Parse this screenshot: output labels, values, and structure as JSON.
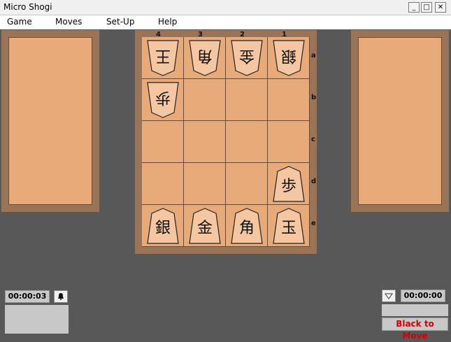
{
  "window": {
    "title": "Micro Shogi",
    "min": "_",
    "max": "□",
    "close": "✕"
  },
  "menu": [
    "Game",
    "Moves",
    "Set-Up",
    "Help"
  ],
  "board": {
    "files": [
      "4",
      "3",
      "2",
      "1"
    ],
    "ranks": [
      "a",
      "b",
      "c",
      "d",
      "e"
    ],
    "pieces": [
      {
        "char": "王",
        "file": "4",
        "rank": "a",
        "side": "white"
      },
      {
        "char": "角",
        "file": "3",
        "rank": "a",
        "side": "white"
      },
      {
        "char": "金",
        "file": "2",
        "rank": "a",
        "side": "white"
      },
      {
        "char": "銀",
        "file": "1",
        "rank": "a",
        "side": "white"
      },
      {
        "char": "歩",
        "file": "4",
        "rank": "b",
        "side": "white"
      },
      {
        "char": "歩",
        "file": "1",
        "rank": "d",
        "side": "black"
      },
      {
        "char": "銀",
        "file": "4",
        "rank": "e",
        "side": "black"
      },
      {
        "char": "金",
        "file": "3",
        "rank": "e",
        "side": "black"
      },
      {
        "char": "角",
        "file": "2",
        "rank": "e",
        "side": "black"
      },
      {
        "char": "玉",
        "file": "1",
        "rank": "e",
        "side": "black"
      }
    ]
  },
  "left_clock": {
    "time": "00:00:03",
    "turn_icon": "bell-icon"
  },
  "right_clock": {
    "time": "00:00:00",
    "turn_icon": "down-triangle-icon"
  },
  "status": {
    "text": "Black to Move",
    "color": "#d40000"
  },
  "colors": {
    "board": "#e8aa78",
    "frame": "#9b7458",
    "background": "#585858",
    "piece": "#f5c6a2"
  }
}
